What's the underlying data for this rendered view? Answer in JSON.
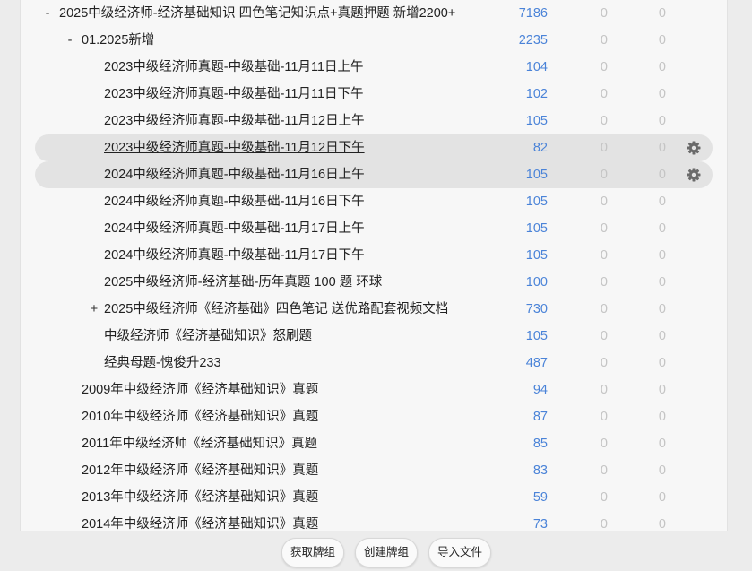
{
  "deck_list": {
    "rows": [
      {
        "toggle": "-",
        "name": "2025中级经济师-经济基础知识 四色笔记知识点+真题押题 新增2200+",
        "total": "7186",
        "c2": "0",
        "c3": "0"
      },
      {
        "toggle": "-",
        "name": "01.2025新增",
        "total": "2235",
        "c2": "0",
        "c3": "0"
      },
      {
        "toggle": "",
        "name": "2023中级经济师真题-中级基础-11月11日上午",
        "total": "104",
        "c2": "0",
        "c3": "0"
      },
      {
        "toggle": "",
        "name": "2023中级经济师真题-中级基础-11月11日下午",
        "total": "102",
        "c2": "0",
        "c3": "0"
      },
      {
        "toggle": "",
        "name": "2023中级经济师真题-中级基础-11月12日上午",
        "total": "105",
        "c2": "0",
        "c3": "0"
      },
      {
        "toggle": "",
        "name": "2023中级经济师真题-中级基础-11月12日下午",
        "total": "82",
        "c2": "0",
        "c3": "0"
      },
      {
        "toggle": "",
        "name": "2024中级经济师真题-中级基础-11月16日上午",
        "total": "105",
        "c2": "0",
        "c3": "0"
      },
      {
        "toggle": "",
        "name": "2024中级经济师真题-中级基础-11月16日下午",
        "total": "105",
        "c2": "0",
        "c3": "0"
      },
      {
        "toggle": "",
        "name": "2024中级经济师真题-中级基础-11月17日上午",
        "total": "105",
        "c2": "0",
        "c3": "0"
      },
      {
        "toggle": "",
        "name": "2024中级经济师真题-中级基础-11月17日下午",
        "total": "105",
        "c2": "0",
        "c3": "0"
      },
      {
        "toggle": "",
        "name": "2025中级经济师-经济基础-历年真题 100 题 环球",
        "total": "100",
        "c2": "0",
        "c3": "0"
      },
      {
        "toggle": "+",
        "name": "2025中级经济师《经济基础》四色笔记 送优路配套视频文档",
        "total": "730",
        "c2": "0",
        "c3": "0"
      },
      {
        "toggle": "",
        "name": "中级经济师《经济基础知识》怒刷题",
        "total": "105",
        "c2": "0",
        "c3": "0"
      },
      {
        "toggle": "",
        "name": "经典母题-愧俊升233",
        "total": "487",
        "c2": "0",
        "c3": "0"
      },
      {
        "toggle": "",
        "name": "2009年中级经济师《经济基础知识》真题",
        "total": "94",
        "c2": "0",
        "c3": "0"
      },
      {
        "toggle": "",
        "name": "2010年中级经济师《经济基础知识》真题",
        "total": "87",
        "c2": "0",
        "c3": "0"
      },
      {
        "toggle": "",
        "name": "2011年中级经济师《经济基础知识》真题",
        "total": "85",
        "c2": "0",
        "c3": "0"
      },
      {
        "toggle": "",
        "name": "2012年中级经济师《经济基础知识》真题",
        "total": "83",
        "c2": "0",
        "c3": "0"
      },
      {
        "toggle": "",
        "name": "2013年中级经济师《经济基础知识》真题",
        "total": "59",
        "c2": "0",
        "c3": "0"
      },
      {
        "toggle": "",
        "name": "2014年中级经济师《经济基础知识》真题",
        "total": "73",
        "c2": "0",
        "c3": "0"
      }
    ]
  },
  "bottom_bar": {
    "get_decks": "获取牌组",
    "create_deck": "创建牌组",
    "import_file": "导入文件"
  },
  "icons": {
    "options": "gear-icon"
  },
  "colors": {
    "count_blue": "#4a83d8",
    "zero_gray": "#c4c4c4",
    "highlight": "#e3e3e3"
  }
}
